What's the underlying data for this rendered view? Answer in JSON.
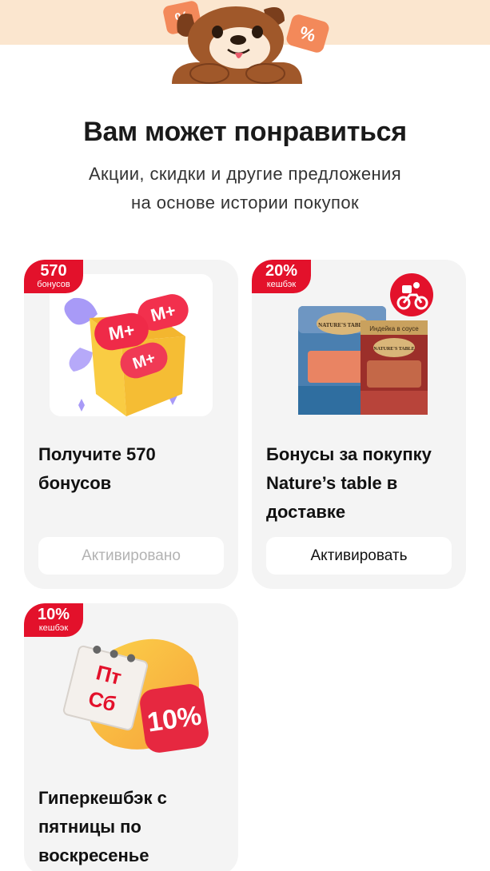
{
  "header": {
    "title": "Вам может понравиться",
    "subtitle_line1": "Акции, скидки и другие предложения",
    "subtitle_line2": "на основе истории покупок",
    "percent_sign": "%"
  },
  "colors": {
    "accent_red": "#e3112b",
    "band": "#fbe6cf",
    "card_bg": "#f4f4f4",
    "box_yellow": "#f9cc43"
  },
  "offers": [
    {
      "badge_value": "570",
      "badge_caption": "бонусов",
      "title": "Получите 570 бонусов",
      "button_label": "Активировано",
      "image_icon": "gift-box-m-plus-icon",
      "mplus": "М+"
    },
    {
      "badge_value": "20%",
      "badge_caption": "кешбэк",
      "title": "Бонусы за покупку Nature’s table в доставке",
      "button_label": "Активировать",
      "image_icon": "cat-food-pouches-icon",
      "pouch_text": "NATURE'S TABLE",
      "pouch_tag": "Индейка в соусе",
      "delivery_icon": "courier-bike-icon"
    },
    {
      "badge_value": "10%",
      "badge_caption": "кешбэк",
      "title": "Гиперкешбэк с пятницы по воскресенье",
      "image_icon": "calendar-10-percent-icon",
      "cal_line1": "Пт",
      "cal_line2": "Сб",
      "big_percent": "10%"
    }
  ]
}
